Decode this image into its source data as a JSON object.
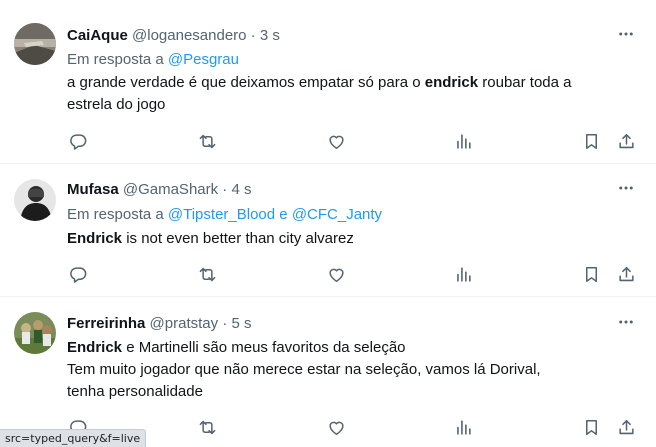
{
  "tweets": [
    {
      "name": "CaiAque",
      "handle": "@loganesandero",
      "dot": "·",
      "time": "3 s",
      "reply_prefix": "Em resposta a",
      "reply_to_1": "@Pesgrau",
      "reply_joiner": "",
      "reply_to_2": "",
      "text_before": "a grande verdade é que deixamos empatar só para o",
      "highlight": "endrick",
      "text_after": "roubar toda a",
      "text_line2": "estrela do jogo"
    },
    {
      "name": "Mufasa",
      "handle": "@GamaShark",
      "dot": "·",
      "time": "4 s",
      "reply_prefix": "Em resposta a",
      "reply_to_1": "@Tipster_Blood",
      "reply_joiner": "e",
      "reply_to_2": "@CFC_Janty",
      "highlight": "Endrick",
      "text_after": "is not even better than city alvarez"
    },
    {
      "name": "Ferreirinha",
      "handle": "@pratstay",
      "dot": "·",
      "time": "5 s",
      "highlight": "Endrick",
      "text_after": "e Martinelli são meus favoritos da seleção",
      "text_line2": "Tem muito jogador que não merece estar na seleção, vamos lá Dorival,",
      "text_line3": "tenha personalidade"
    }
  ],
  "status_bar": "src=typed_query&f=live",
  "icons": [
    "more-icon",
    "reply-icon",
    "retweet-icon",
    "like-icon",
    "views-icon",
    "bookmark-icon",
    "share-icon"
  ],
  "colors": {
    "text": "#0f1419",
    "secondary": "#536471",
    "link": "#1d9bf0",
    "divider": "#eff3f4"
  }
}
